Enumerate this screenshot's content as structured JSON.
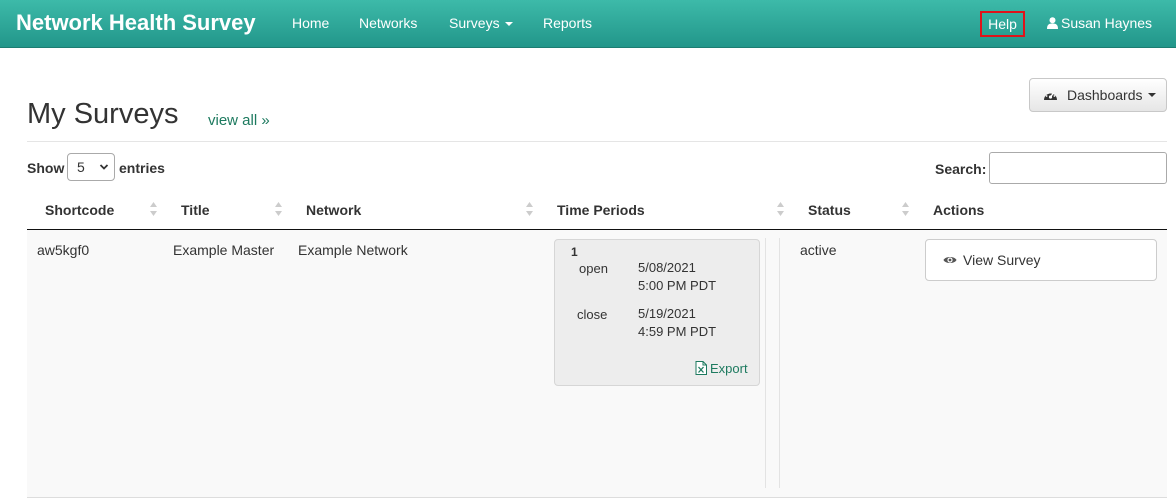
{
  "navbar": {
    "brand": "Network Health Survey",
    "items": [
      {
        "label": "Home"
      },
      {
        "label": "Networks"
      },
      {
        "label": "Surveys"
      },
      {
        "label": "Reports"
      }
    ],
    "help_label": "Help",
    "user_name": "Susan Haynes",
    "colors": {
      "bar_top": "#3dbaa9",
      "bar_bottom": "#22968a",
      "help_outline": "#e0131a"
    }
  },
  "header": {
    "title": "My Surveys",
    "view_all_label": "view all »",
    "dashboards_label": "Dashboards"
  },
  "table_controls": {
    "show_label": "Show",
    "page_size": "5",
    "entries_label": "entries",
    "search_label": "Search:",
    "search_value": ""
  },
  "table": {
    "columns": [
      "Shortcode",
      "Title",
      "Network",
      "Time Periods",
      "Status",
      "Actions"
    ],
    "rows": [
      {
        "shortcode": "aw5kgf0",
        "title": "Example Master",
        "network": "Example Network",
        "time_period": {
          "number": "1",
          "open_label": "open",
          "open_date": "5/08/2021",
          "open_time": "5:00 PM PDT",
          "close_label": "close",
          "close_date": "5/19/2021",
          "close_time": "4:59 PM PDT",
          "export_label": "Export"
        },
        "status": "active",
        "action_label": "View Survey"
      }
    ]
  },
  "icons": {
    "user": "user-icon",
    "dashboard": "dashboard-gauge-icon",
    "sort": "sort-icon",
    "export": "excel-file-icon",
    "view": "eye-icon"
  }
}
